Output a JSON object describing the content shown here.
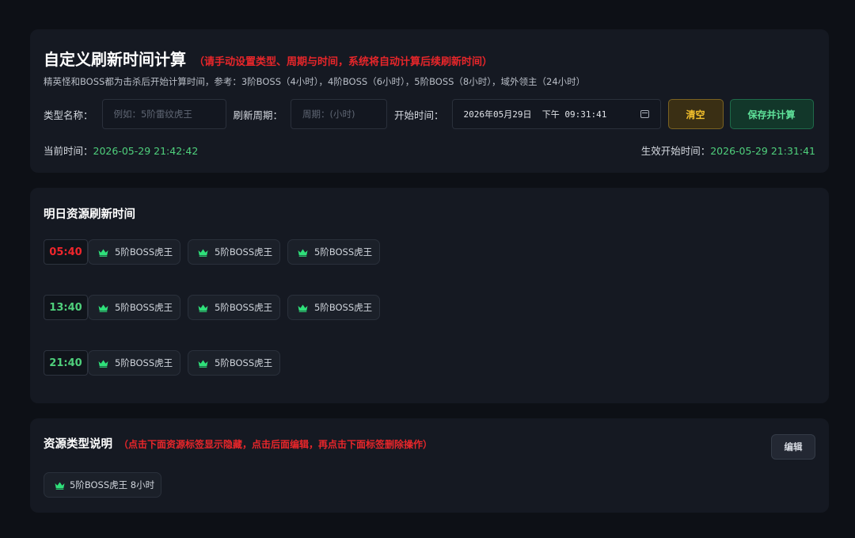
{
  "calc": {
    "title": "自定义刷新时间计算",
    "title_note": "（请手动设置类型、周期与时间，系统将自动计算后续刷新时间）",
    "description": "精英怪和BOSS都为击杀后开始计算时间，参考：3阶BOSS（4小时），4阶BOSS（6小时），5阶BOSS（8小时），域外领主（24小时）",
    "type_name_label": "类型名称：",
    "type_name_placeholder": "例如：5阶雷纹虎王",
    "type_name_value": "",
    "period_label": "刷新周期：",
    "period_placeholder": "周期：(小时)",
    "period_value": "",
    "start_label": "开始时间：",
    "start_value": "2026年05月29日  下午 09:31:41",
    "clear_label": "清空",
    "save_label": "保存并计算",
    "current_time_label": "当前时间：",
    "current_time_value": "2026-05-29 21:42:42",
    "effective_time_label": "生效开始时间：",
    "effective_time_value": "2026-05-29 21:31:41"
  },
  "tomorrow": {
    "title": "明日资源刷新时间",
    "slots": [
      {
        "time": "05:40",
        "color": "#f0262c",
        "items": [
          "5阶BOSS虎王",
          "5阶BOSS虎王",
          "5阶BOSS虎王"
        ]
      },
      {
        "time": "13:40",
        "color": "#4fd07c",
        "items": [
          "5阶BOSS虎王",
          "5阶BOSS虎王",
          "5阶BOSS虎王"
        ]
      },
      {
        "time": "21:40",
        "color": "#4fd07c",
        "items": [
          "5阶BOSS虎王",
          "5阶BOSS虎王"
        ]
      }
    ]
  },
  "legend": {
    "title": "资源类型说明",
    "note": "（点击下面资源标签显示隐藏，点击后面编辑，再点击下面标签删除操作）",
    "edit_label": "编辑",
    "items": [
      {
        "label": "5阶BOSS虎王 8小时"
      }
    ]
  },
  "icons": {
    "crown": "crown-icon",
    "calendar": "calendar-icon"
  },
  "colors": {
    "accent_green": "#4fd07c",
    "accent_red": "#e8262a",
    "crown": "#2fe07a",
    "warn": "#f5c12c"
  }
}
